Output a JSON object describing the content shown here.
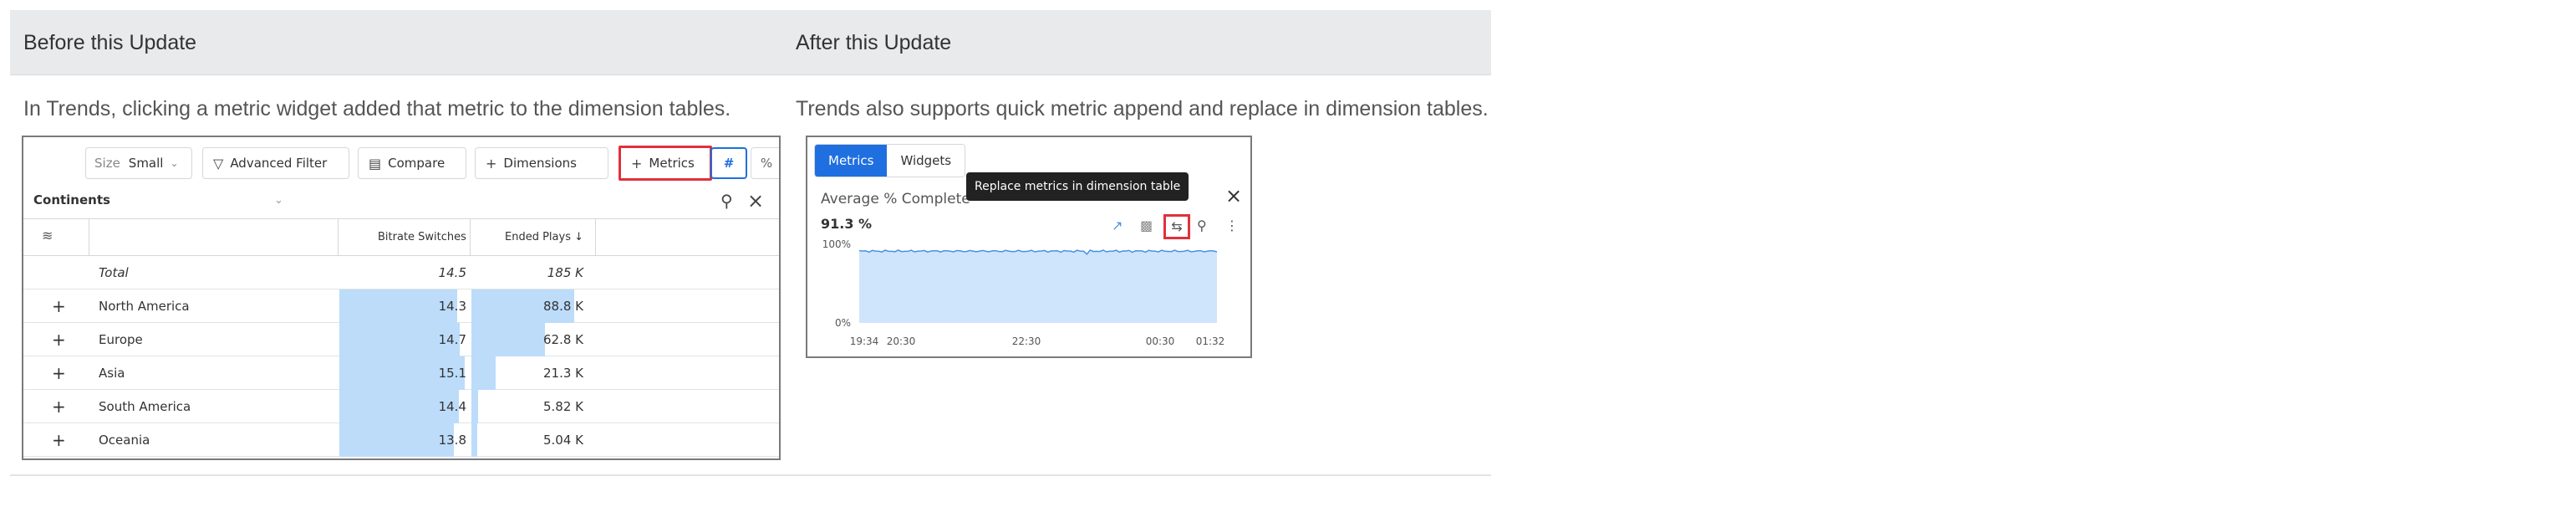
{
  "table": {
    "header_before": "Before this Update",
    "header_after": "After this Update",
    "desc_before": "In Trends, clicking a metric widget added that metric to the dimension tables.",
    "desc_after": "Trends also supports quick metric append and replace in dimension tables."
  },
  "before": {
    "toolbar": {
      "size_label": "Size",
      "size_value": "Small",
      "advanced_filter": "Advanced Filter",
      "compare": "Compare",
      "dimensions": "Dimensions",
      "metrics": "Metrics",
      "hash": "#",
      "percent": "%"
    },
    "panel_title": "Continents",
    "columns": [
      "Bitrate Switches",
      "Ended Plays ↓"
    ],
    "total": {
      "name": "Total",
      "v1": "14.5",
      "v2": "185 K"
    },
    "rows": [
      {
        "name": "North America",
        "v1": "14.3",
        "v2": "88.8 K",
        "bar1": 0.94,
        "bar2": 0.88
      },
      {
        "name": "Europe",
        "v1": "14.7",
        "v2": "62.8 K",
        "bar1": 0.96,
        "bar2": 0.63
      },
      {
        "name": "Asia",
        "v1": "15.1",
        "v2": "21.3 K",
        "bar1": 1.0,
        "bar2": 0.21
      },
      {
        "name": "South America",
        "v1": "14.4",
        "v2": "5.82 K",
        "bar1": 0.95,
        "bar2": 0.06
      },
      {
        "name": "Oceania",
        "v1": "13.8",
        "v2": "5.04 K",
        "bar1": 0.91,
        "bar2": 0.05
      }
    ],
    "colors": {
      "bar": "#bcdcfa",
      "highlight": "#e0313b",
      "accent": "#1f6fe0"
    }
  },
  "after": {
    "tabs": [
      "Metrics",
      "Widgets"
    ],
    "card_title": "Average % Complete",
    "card_value": "91.3 %",
    "tooltip": "Replace metrics in dimension table",
    "icons": [
      "line-chart-icon",
      "bar-chart-icon",
      "replace-icon",
      "zoom-icon",
      "more-icon"
    ],
    "chart_data": {
      "type": "area",
      "x": [
        "19:34",
        "20:30",
        "22:30",
        "00:30",
        "01:32"
      ],
      "ylim": [
        0,
        100
      ],
      "yticks": [
        "100%",
        "0%"
      ],
      "level": 91.3,
      "color": "#4a90e2",
      "fill": "#cfe5fb"
    }
  }
}
